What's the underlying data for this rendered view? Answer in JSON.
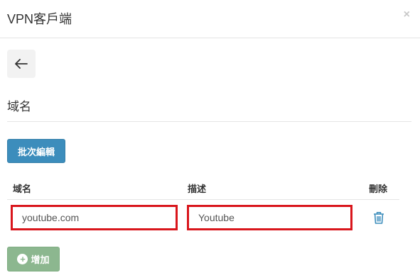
{
  "modal": {
    "title": "VPN客戶端",
    "close_label": "×"
  },
  "section": {
    "title": "域名"
  },
  "toolbar": {
    "batch_edit_label": "批次編輯"
  },
  "table": {
    "headers": {
      "domain": "域名",
      "description": "描述",
      "delete": "刪除"
    },
    "rows": [
      {
        "domain": "youtube.com",
        "description": "Youtube"
      }
    ]
  },
  "footer": {
    "add_label": "增加"
  },
  "icons": {
    "back": "arrow-left-icon",
    "delete": "trash-icon",
    "add": "plus-circle-icon"
  },
  "colors": {
    "primary": "#3c8dbc",
    "success_disabled": "#8cb78f",
    "highlight_border": "#d9161c",
    "delete_icon": "#3c8dbc"
  }
}
